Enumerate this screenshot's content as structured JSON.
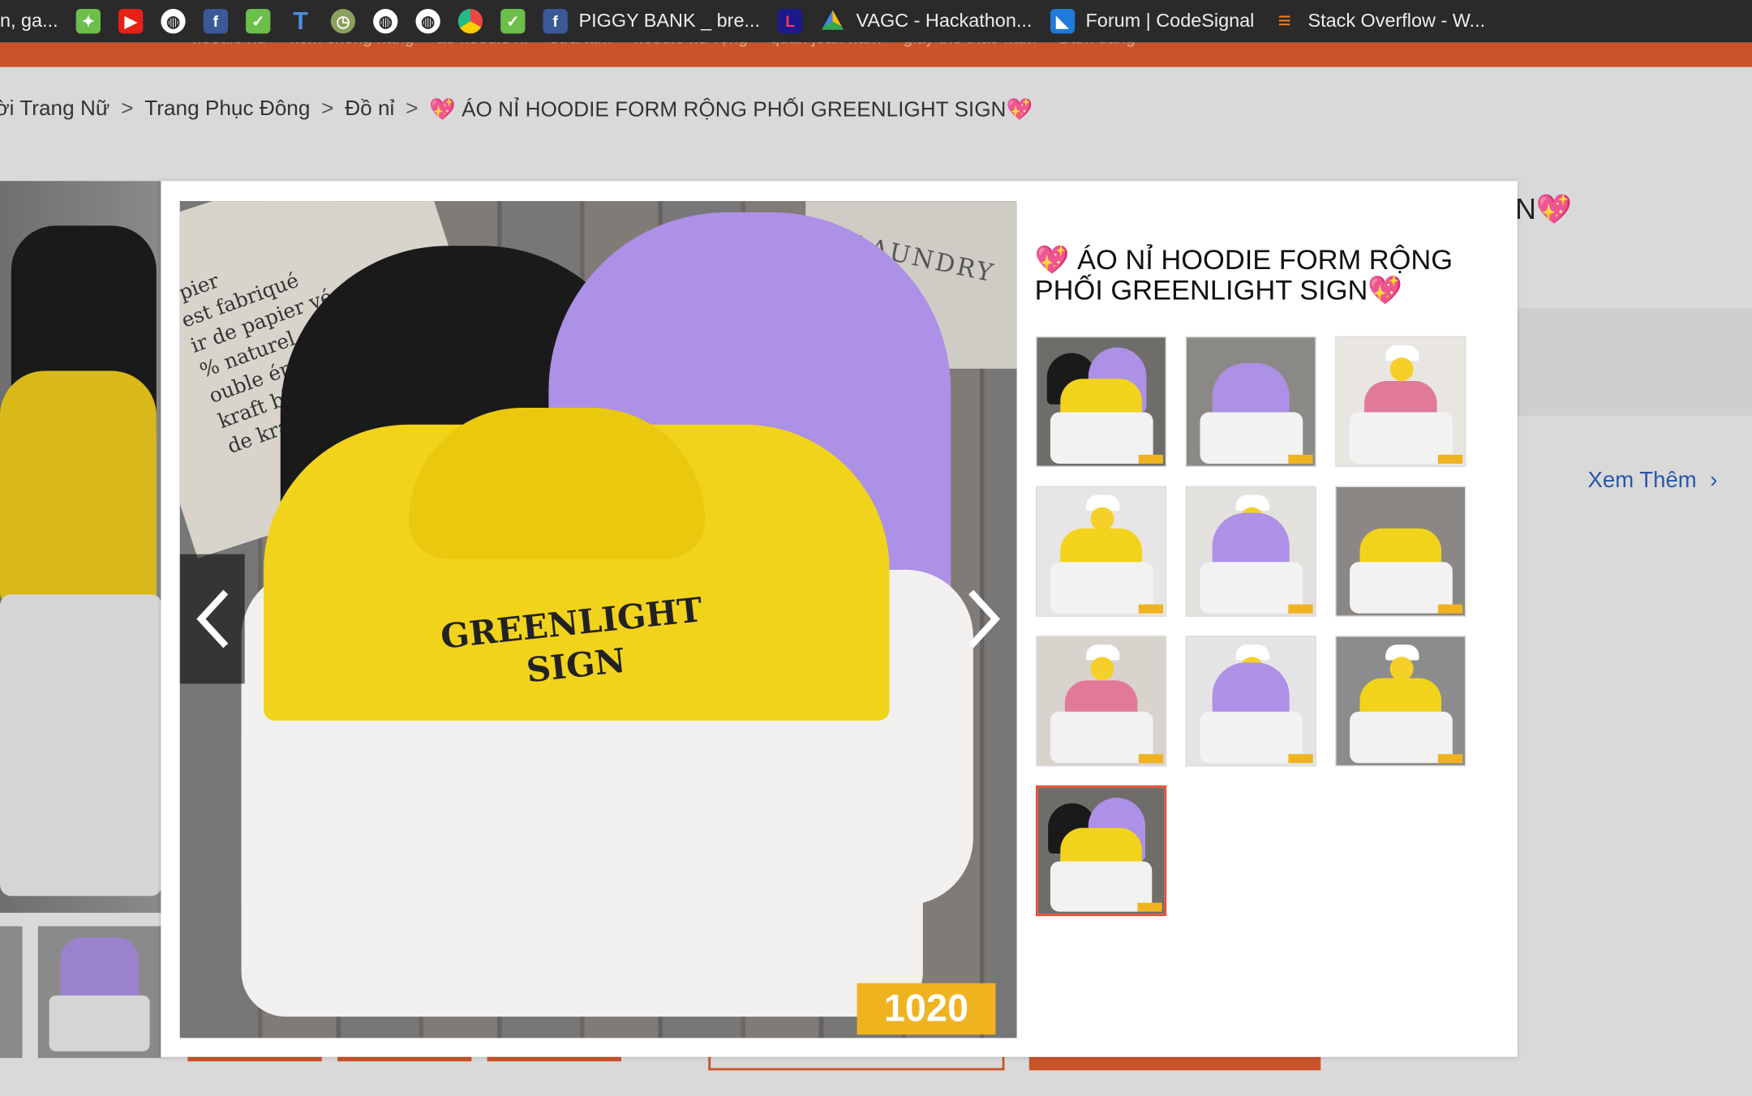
{
  "bookmarks": [
    {
      "label": "n, ga...",
      "icon": "globe-icon"
    },
    {
      "label": "",
      "icon": "green-app-icon"
    },
    {
      "label": "",
      "icon": "youtube-icon"
    },
    {
      "label": "",
      "icon": "globe-icon"
    },
    {
      "label": "",
      "icon": "facebook-icon"
    },
    {
      "label": "",
      "icon": "green-check-icon"
    },
    {
      "label": "",
      "icon": "t-icon"
    },
    {
      "label": "",
      "icon": "clock-icon"
    },
    {
      "label": "",
      "icon": "globe-icon"
    },
    {
      "label": "",
      "icon": "globe-icon"
    },
    {
      "label": "",
      "icon": "chrome-icon"
    },
    {
      "label": "",
      "icon": "green-check-icon"
    },
    {
      "label": "PIGGY BANK _ bre...",
      "icon": "facebook-icon"
    },
    {
      "label": "",
      "icon": "lazada-icon"
    },
    {
      "label": "VAGC - Hackathon...",
      "icon": "google-drive-icon"
    },
    {
      "label": "Forum | CodeSignal",
      "icon": "codesignal-icon"
    },
    {
      "label": "Stack Overflow - W...",
      "icon": "stackoverflow-icon"
    }
  ],
  "topnav": [
    "hoodie nữ",
    "kem chống nắng",
    "áo hoodie nỉ",
    "sữa tắm",
    "hoodie nữ rộng",
    "quần jean nam",
    "giày thể thao nam",
    "Bấm đăng"
  ],
  "breadcrumb": [
    "ời Trang Nữ",
    "Trang Phục Đông",
    "Đồ nỉ",
    "💖 ÁO NỈ HOODIE FORM RỘNG PHỐI GREENLIGHT SIGN💖"
  ],
  "background": {
    "title_tail": "N💖",
    "see_more": "Xem Thêm"
  },
  "modal": {
    "title": "💖 ÁO NỈ HOODIE FORM RỘNG PHỐI GREENLIGHT SIGN💖",
    "main_image": {
      "paper_text": "-pier\nest fabriqué\nir de papier végétal\n% naturel.\nouble épaisseur 180g/m².\nkraft blanc doublé\nde kraft brun",
      "box_text": "LAUNDRY",
      "logo_line1": "GREENLIGHT",
      "logo_line2": "SIGN",
      "badge": "1020"
    },
    "thumbnails": [
      {
        "variant": "yellow-purple-black",
        "active": false
      },
      {
        "variant": "purple-flat",
        "active": false
      },
      {
        "variant": "pink-model",
        "active": false
      },
      {
        "variant": "yellow-model",
        "active": false
      },
      {
        "variant": "purple-model",
        "active": false
      },
      {
        "variant": "yellow-flat",
        "active": false
      },
      {
        "variant": "pink-sitting",
        "active": false
      },
      {
        "variant": "purple-sitting",
        "active": false
      },
      {
        "variant": "yellow-model-cap",
        "active": false
      },
      {
        "variant": "yellow-purple-black",
        "active": true
      }
    ]
  }
}
